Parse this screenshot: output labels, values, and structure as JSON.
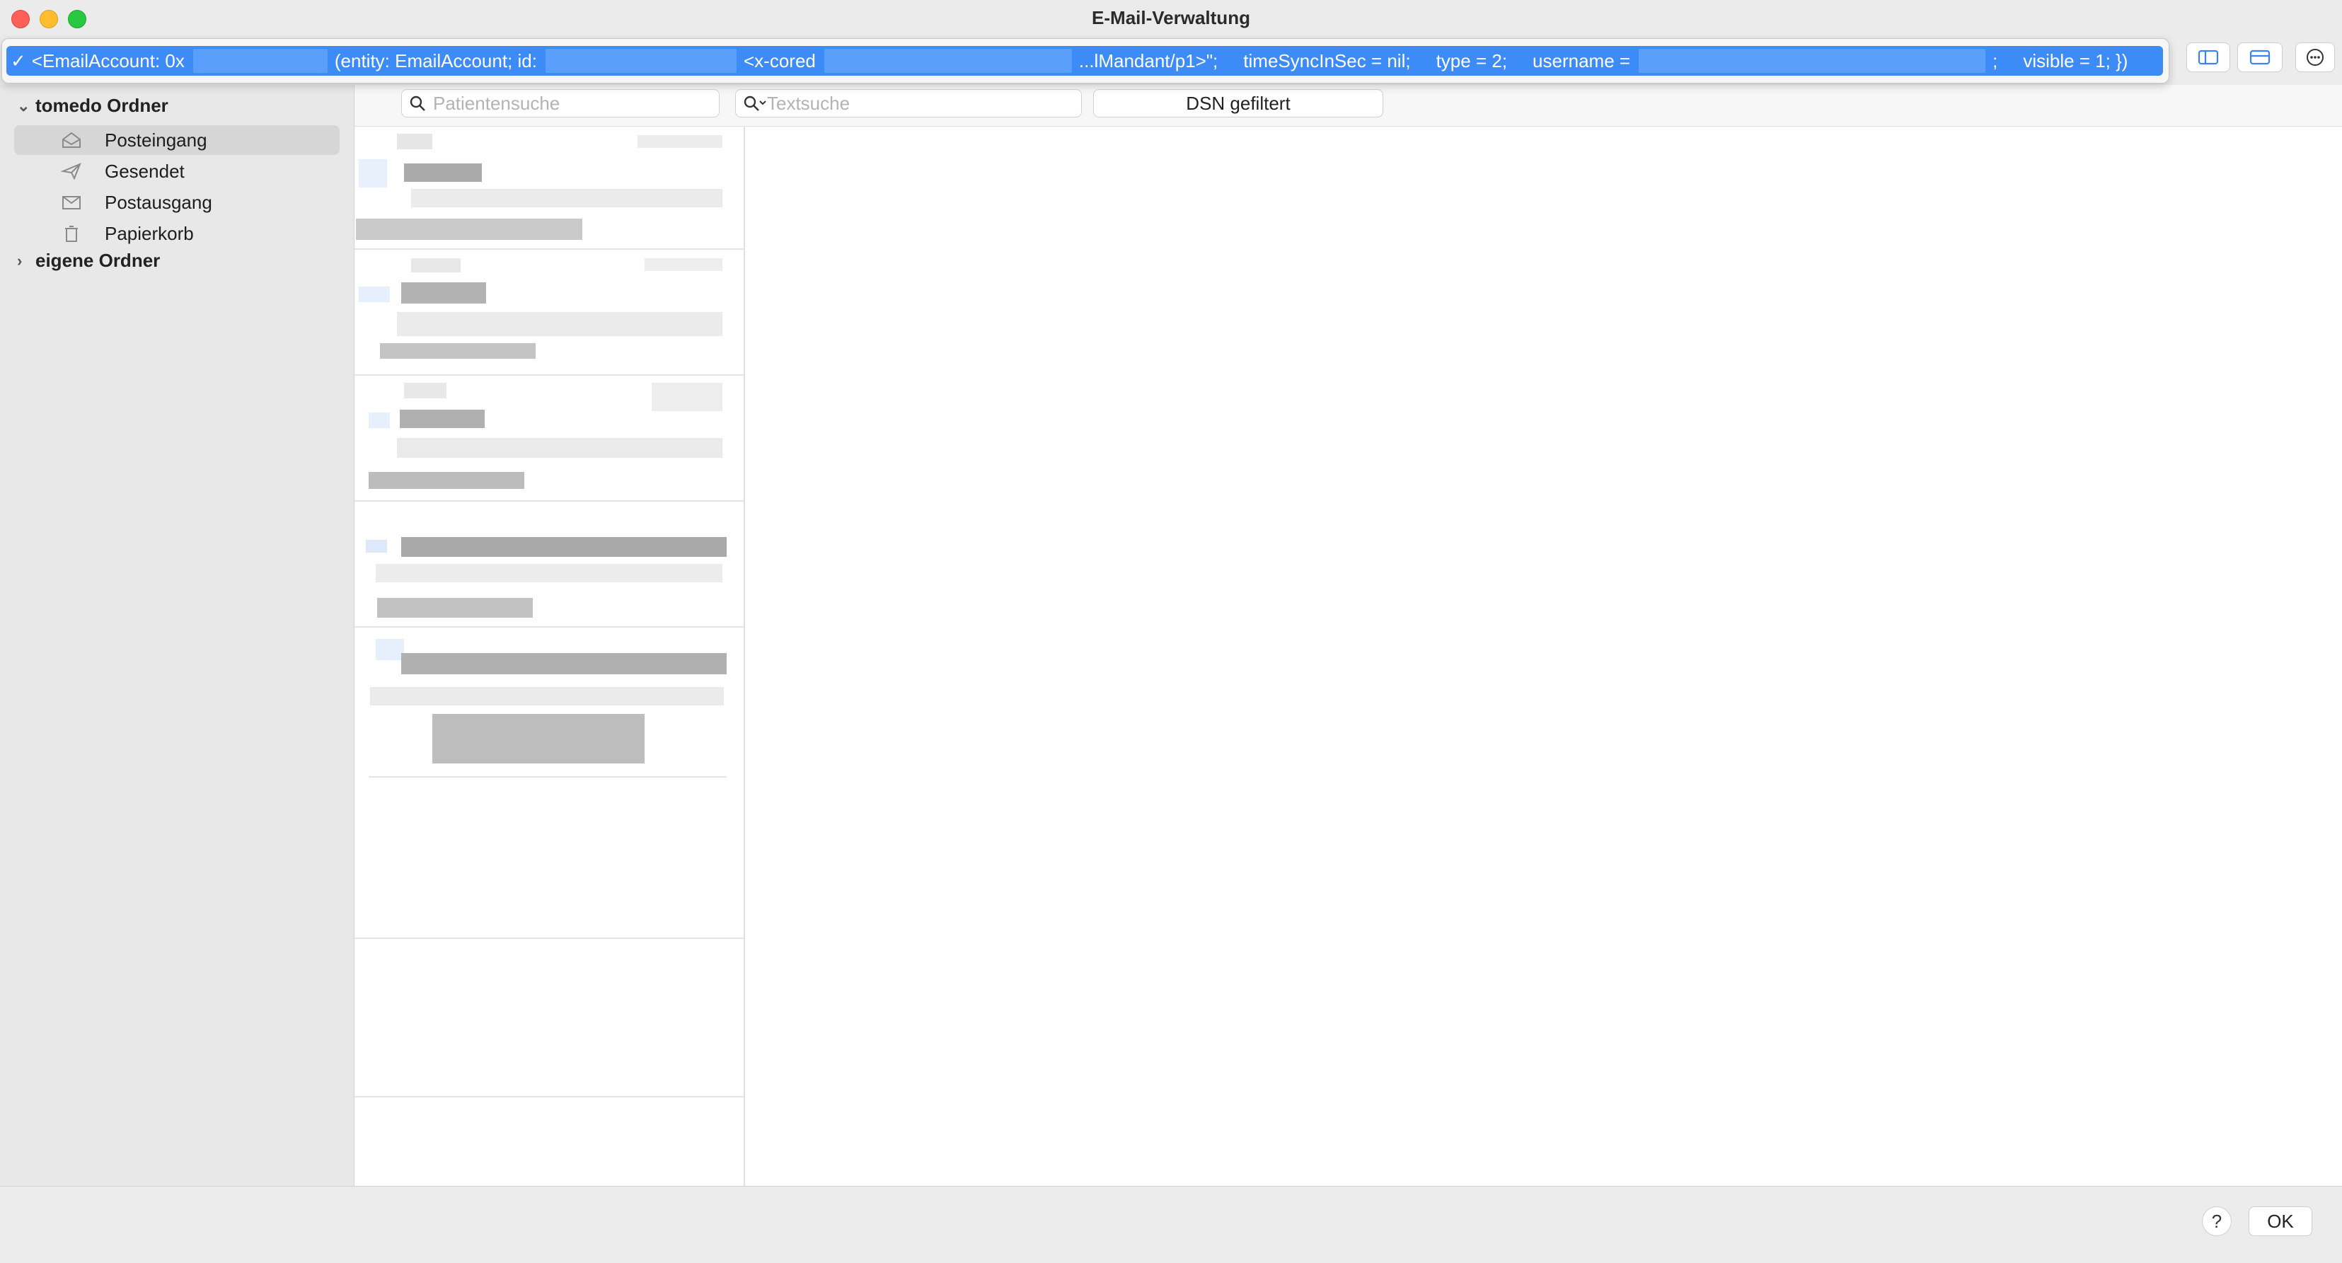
{
  "window": {
    "title": "E-Mail-Verwaltung"
  },
  "account_selector": {
    "checkmark": "✓",
    "seg1": "<EmailAccount: 0x",
    "seg2": "(entity: EmailAccount; id:",
    "seg3": "<x-cored",
    "seg4": "...lMandant/p1>\";",
    "seg5": "timeSyncInSec = nil;",
    "seg6": "type = 2;",
    "seg7": "username =",
    "seg8": ";",
    "seg9": "visible = 1; })"
  },
  "sidebar": {
    "group1": {
      "label": "tomedo Ordner",
      "chevron": "⌄"
    },
    "items": [
      {
        "label": "Posteingang",
        "icon": "inbox-icon",
        "selected": true
      },
      {
        "label": "Gesendet",
        "icon": "paperplane-icon",
        "selected": false
      },
      {
        "label": "Postausgang",
        "icon": "outbox-icon",
        "selected": false
      },
      {
        "label": "Papierkorb",
        "icon": "trash-icon",
        "selected": false
      }
    ],
    "group2": {
      "label": "eigene Ordner",
      "chevron": "›"
    }
  },
  "search": {
    "patient_placeholder": "Patientensuche",
    "text_placeholder": "Textsuche",
    "dsn_button": "DSN gefiltert"
  },
  "footer": {
    "help": "?",
    "ok": "OK"
  },
  "colors": {
    "selection": "#3d8bf7",
    "sidebar": "#e8e8e8",
    "window": "#ececec"
  }
}
